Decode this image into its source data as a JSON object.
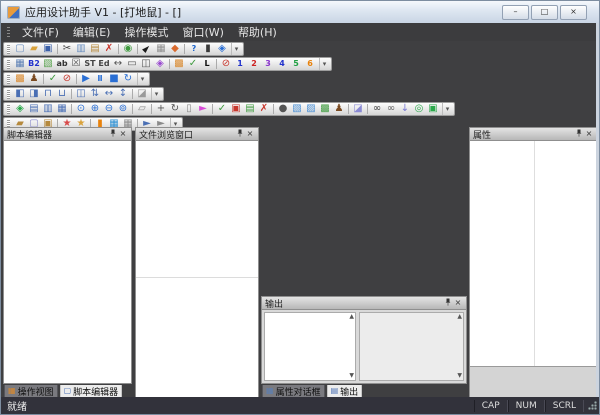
{
  "window": {
    "title": "应用设计助手 V1 - [打地鼠] - []",
    "controls": {
      "minimize_glyph": "–",
      "restore_glyph": "□",
      "close_glyph": "×"
    }
  },
  "menu": {
    "items": [
      {
        "key": "file",
        "label": "文件(F)"
      },
      {
        "key": "edit",
        "label": "编辑(E)"
      },
      {
        "key": "mode",
        "label": "操作模式"
      },
      {
        "key": "window",
        "label": "窗口(W)"
      },
      {
        "key": "help",
        "label": "帮助(H)"
      }
    ]
  },
  "toolbars": {
    "overflow_glyph": "▾",
    "rows": [
      {
        "name": "standard",
        "groups": [
          [
            {
              "name": "new-file-icon",
              "glyph": "▢",
              "color": "#6b8fbf"
            },
            {
              "name": "open-folder-icon",
              "glyph": "▰",
              "color": "#d9a23c"
            },
            {
              "name": "save-icon",
              "glyph": "▣",
              "color": "#3a5fa8"
            }
          ],
          [
            {
              "name": "cut-icon",
              "glyph": "✂",
              "color": "#444444"
            },
            {
              "name": "copy-icon",
              "glyph": "▥",
              "color": "#6b8fbf"
            },
            {
              "name": "paste-icon",
              "glyph": "▤",
              "color": "#b5893d"
            },
            {
              "name": "delete-icon",
              "glyph": "✗",
              "color": "#c8372d"
            }
          ],
          [
            {
              "name": "syntax-check-icon",
              "glyph": "◉",
              "color": "#3f9b3f"
            }
          ],
          [
            {
              "name": "select-cursor-icon",
              "glyph": "►",
              "color": "#1a1a1a",
              "cls": "rot315"
            },
            {
              "name": "grid-toggle-icon",
              "glyph": "▦",
              "color": "#8f8f8f"
            },
            {
              "name": "palette-icon",
              "glyph": "◆",
              "color": "#d96a2e"
            }
          ],
          [
            {
              "name": "help-icon",
              "glyph": "?",
              "color": "#1f66cc",
              "cls": "txt"
            },
            {
              "name": "device-icon",
              "glyph": "▮",
              "color": "#3a3a3a"
            },
            {
              "name": "component-icon",
              "glyph": "◈",
              "color": "#2a6fd4"
            }
          ]
        ]
      },
      {
        "name": "controls",
        "groups": [
          [
            {
              "name": "table-control-icon",
              "glyph": "▦",
              "color": "#5b7fb4"
            },
            {
              "name": "label-control-icon",
              "glyph": "B2",
              "color": "#2233cc",
              "cls": "txt"
            },
            {
              "name": "image-control-icon",
              "glyph": "▧",
              "color": "#55a04a"
            },
            {
              "name": "textbox-control-icon",
              "glyph": "ab",
              "color": "#333333",
              "cls": "txt"
            },
            {
              "name": "checkbox-control-icon",
              "glyph": "☒",
              "color": "#555555"
            },
            {
              "name": "static-control-icon",
              "glyph": "ST",
              "color": "#444444",
              "cls": "txt"
            },
            {
              "name": "edit-control-icon",
              "glyph": "Ed",
              "color": "#444444",
              "cls": "txt"
            },
            {
              "name": "slider-control-icon",
              "glyph": "↔",
              "color": "#555555"
            },
            {
              "name": "progress-control-icon",
              "glyph": "▭",
              "color": "#555555"
            },
            {
              "name": "combo-control-icon",
              "glyph": "◫",
              "color": "#555555"
            },
            {
              "name": "resource-control-icon",
              "glyph": "◈",
              "color": "#9a4ad0"
            }
          ],
          [
            {
              "name": "layout-grid-icon",
              "glyph": "▩",
              "color": "#d9892e"
            },
            {
              "name": "apply-check-icon",
              "glyph": "✓",
              "color": "#3f9b3f"
            },
            {
              "name": "letter-l-icon",
              "glyph": "L",
              "color": "#111111",
              "cls": "txt"
            }
          ],
          [
            {
              "name": "disable-icon",
              "glyph": "⊘",
              "color": "#c8372d"
            },
            {
              "name": "order-1-icon",
              "glyph": "1",
              "color": "#2233cc",
              "cls": "txt"
            },
            {
              "name": "order-2-icon",
              "glyph": "2",
              "color": "#cc2222",
              "cls": "txt"
            },
            {
              "name": "order-3-icon",
              "glyph": "3",
              "color": "#8833cc",
              "cls": "txt"
            },
            {
              "name": "order-4-icon",
              "glyph": "4",
              "color": "#2233cc",
              "cls": "txt"
            },
            {
              "name": "order-5-icon",
              "glyph": "5",
              "color": "#22a044",
              "cls": "txt"
            },
            {
              "name": "order-6-icon",
              "glyph": "6",
              "color": "#e8820c",
              "cls": "txt"
            }
          ]
        ]
      },
      {
        "name": "run",
        "groups": [
          [
            {
              "name": "designer-view-icon",
              "glyph": "▩",
              "color": "#d9892e"
            },
            {
              "name": "actor-icon",
              "glyph": "♟",
              "color": "#7a4a20"
            }
          ],
          [
            {
              "name": "run-check-icon",
              "glyph": "✓",
              "color": "#3f9b3f"
            },
            {
              "name": "run-block-icon",
              "glyph": "⊘",
              "color": "#c8372d"
            }
          ],
          [
            {
              "name": "play-icon",
              "glyph": "▶",
              "color": "#2a6fd4"
            },
            {
              "name": "pause-icon",
              "glyph": "Ⅱ",
              "color": "#2a6fd4",
              "cls": "txt"
            },
            {
              "name": "stop-icon",
              "glyph": "■",
              "color": "#2a6fd4"
            },
            {
              "name": "loop-icon",
              "glyph": "↻",
              "color": "#2a6fd4"
            }
          ]
        ]
      },
      {
        "name": "align",
        "groups": [
          [
            {
              "name": "align-left-icon",
              "glyph": "◧",
              "color": "#4a6fb4"
            },
            {
              "name": "align-right-icon",
              "glyph": "◨",
              "color": "#4a6fb4"
            },
            {
              "name": "align-top-icon",
              "glyph": "⊓",
              "color": "#4a6fb4"
            },
            {
              "name": "align-bottom-icon",
              "glyph": "⊔",
              "color": "#4a6fb4"
            }
          ],
          [
            {
              "name": "center-horizontal-icon",
              "glyph": "◫",
              "color": "#4a6fb4"
            },
            {
              "name": "center-vertical-icon",
              "glyph": "⇅",
              "color": "#4a6fb4"
            },
            {
              "name": "same-width-icon",
              "glyph": "↔",
              "color": "#4a6fb4"
            },
            {
              "name": "same-height-icon",
              "glyph": "↕",
              "color": "#4a6fb4"
            }
          ],
          [
            {
              "name": "layout-lock-icon",
              "glyph": "◪",
              "color": "#9a9a9a"
            }
          ]
        ]
      },
      {
        "name": "tools",
        "groups": [
          [
            {
              "name": "style-icon",
              "glyph": "◈",
              "color": "#2aa84a"
            },
            {
              "name": "layers-front-icon",
              "glyph": "▤",
              "color": "#4a6fb4"
            },
            {
              "name": "layers-back-icon",
              "glyph": "▥",
              "color": "#4a6fb4"
            },
            {
              "name": "layers-merge-icon",
              "glyph": "▦",
              "color": "#4a6fb4"
            }
          ],
          [
            {
              "name": "info-icon",
              "glyph": "⊙",
              "color": "#2a6fd4"
            },
            {
              "name": "zoom-in-icon",
              "glyph": "⊕",
              "color": "#2a6fd4"
            },
            {
              "name": "zoom-out-icon",
              "glyph": "⊖",
              "color": "#2a6fd4"
            },
            {
              "name": "zoom-fit-icon",
              "glyph": "⊚",
              "color": "#2a6fd4"
            }
          ],
          [
            {
              "name": "snapshot-icon",
              "glyph": "▱",
              "color": "#8a8a8a"
            }
          ],
          [
            {
              "name": "move-tool-icon",
              "glyph": "+",
              "color": "#555555"
            },
            {
              "name": "rotate-icon",
              "glyph": "↻",
              "color": "#555555"
            },
            {
              "name": "page-icon",
              "glyph": "▯",
              "color": "#888888"
            },
            {
              "name": "transform-icon",
              "glyph": "►",
              "color": "#d84ad8"
            }
          ],
          [
            {
              "name": "verify-icon",
              "glyph": "✓",
              "color": "#3f9b3f"
            },
            {
              "name": "color-block-icon",
              "glyph": "▣",
              "color": "#c8372d"
            },
            {
              "name": "image-ok-icon",
              "glyph": "▤",
              "color": "#3f9b3f"
            },
            {
              "name": "image-delete-icon",
              "glyph": "✗",
              "color": "#c8372d"
            }
          ],
          [
            {
              "name": "cloud-icon",
              "glyph": "●",
              "color": "#555555"
            },
            {
              "name": "image-1-icon",
              "glyph": "▧",
              "color": "#4a8fd4"
            },
            {
              "name": "image-2-icon",
              "glyph": "▨",
              "color": "#4a8fd4"
            },
            {
              "name": "image-3-icon",
              "glyph": "▩",
              "color": "#3f9b3f"
            },
            {
              "name": "actor-2-icon",
              "glyph": "♟",
              "color": "#7a4a20"
            }
          ],
          [
            {
              "name": "layers-diagonal-icon",
              "glyph": "◪",
              "color": "#8a8ad4"
            }
          ],
          [
            {
              "name": "binoculars-icon",
              "glyph": "∞",
              "color": "#444444"
            },
            {
              "name": "binoculars-next-icon",
              "glyph": "∞",
              "color": "#666666"
            },
            {
              "name": "arrow-down-icon",
              "glyph": "↓",
              "color": "#7a7ad4"
            },
            {
              "name": "target-icon",
              "glyph": "◎",
              "color": "#2aa84a"
            },
            {
              "name": "region-icon",
              "glyph": "▣",
              "color": "#2aa84a"
            }
          ]
        ]
      },
      {
        "name": "export",
        "groups": [
          [
            {
              "name": "export-folder-icon",
              "glyph": "▰",
              "color": "#b5893d"
            },
            {
              "name": "export-page-icon",
              "glyph": "▢",
              "color": "#8a8acc"
            },
            {
              "name": "export-package-icon",
              "glyph": "▣",
              "color": "#b5893d"
            }
          ],
          [
            {
              "name": "app-package-1-icon",
              "glyph": "★",
              "color": "#d84a4a"
            },
            {
              "name": "app-package-2-icon",
              "glyph": "★",
              "color": "#d9a23c"
            }
          ],
          [
            {
              "name": "build-orange-icon",
              "glyph": "▮",
              "color": "#e8820c"
            },
            {
              "name": "build-blue-icon",
              "glyph": "▦",
              "color": "#2a8fd4"
            },
            {
              "name": "build-gray-icon",
              "glyph": "▦",
              "color": "#8a8a8a"
            }
          ],
          [
            {
              "name": "deploy-1-icon",
              "glyph": "►",
              "color": "#4a6fb4"
            },
            {
              "name": "deploy-2-icon",
              "glyph": "►",
              "color": "#8a8a8a"
            }
          ]
        ]
      }
    ]
  },
  "panels": {
    "close_glyph": "×",
    "script_editor": {
      "title": "脚本编辑器"
    },
    "file_browser": {
      "title": "文件浏览窗口"
    },
    "properties": {
      "title": "属性"
    },
    "output": {
      "title": "输出",
      "scroll_up_glyph": "▲",
      "scroll_down_glyph": "▼"
    }
  },
  "tabs": {
    "left": [
      {
        "key": "action-view",
        "label": "操作视图",
        "icon_glyph": "▦",
        "icon_color": "#d9892e",
        "active": false
      },
      {
        "key": "script-editor",
        "label": "脚本编辑器",
        "icon_glyph": "▢",
        "icon_color": "#4a6fb4",
        "active": true
      }
    ],
    "middle": [
      {
        "key": "property-dialog",
        "label": "属性对话框",
        "icon_glyph": "▦",
        "icon_color": "#5b7fb4",
        "active": false
      },
      {
        "key": "output",
        "label": "输出",
        "icon_glyph": "▤",
        "icon_color": "#4a6fb4",
        "active": true
      }
    ]
  },
  "statusbar": {
    "ready_text": "就绪",
    "indicators": [
      "CAP",
      "NUM",
      "SCRL"
    ]
  },
  "colors": {
    "titlebar_bg": "#dde6f1",
    "dock_bg": "#3f3f41",
    "statusbar_bg": "#32323b",
    "toolbar_bg": "#e3e3e3",
    "panel_header_bg": "#c6c6c6",
    "accent_blue": "#2a6fd4"
  }
}
